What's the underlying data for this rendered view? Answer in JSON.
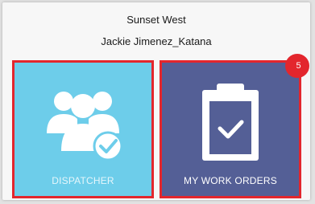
{
  "header": {
    "location": "Sunset West",
    "user": "Jackie Jimenez_Katana"
  },
  "tiles": [
    {
      "label": "DISPATCHER",
      "icon": "group-check-icon",
      "color": "#6dcdea"
    },
    {
      "label": "MY WORK ORDERS",
      "icon": "clipboard-check-icon",
      "color": "#545f96",
      "badge": "5"
    }
  ],
  "highlight_color": "#e3262d"
}
